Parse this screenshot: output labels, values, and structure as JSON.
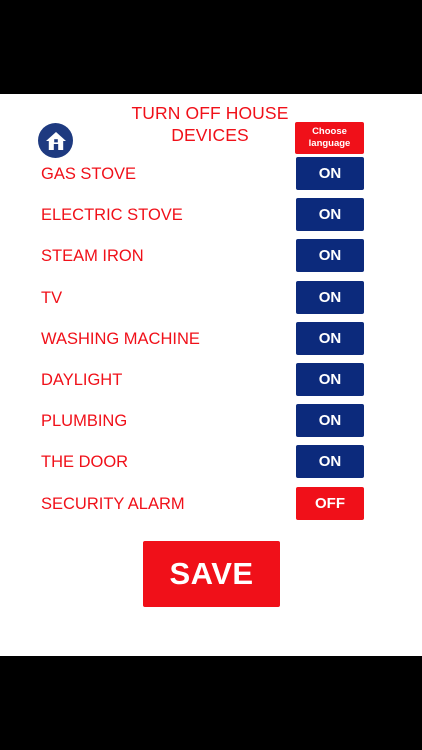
{
  "header": {
    "title_line1": "TURN OFF HOUSE",
    "title_line2": "DEVICES",
    "home_icon": "home-icon",
    "language_button_line1": "Choose",
    "language_button_line2": "language"
  },
  "devices": [
    {
      "label": "GAS STOVE",
      "state": "ON"
    },
    {
      "label": "ELECTRIC STOVE",
      "state": "ON"
    },
    {
      "label": "STEAM IRON",
      "state": "ON"
    },
    {
      "label": "TV",
      "state": "ON"
    },
    {
      "label": "WASHING MACHINE",
      "state": "ON"
    },
    {
      "label": "DAYLIGHT",
      "state": "ON"
    },
    {
      "label": "PLUMBING",
      "state": "ON"
    },
    {
      "label": "THE DOOR",
      "state": "ON"
    },
    {
      "label": "SECURITY ALARM",
      "state": "OFF"
    }
  ],
  "save_label": "SAVE",
  "colors": {
    "accent_red": "#f01019",
    "on_blue": "#0c2a7c",
    "home_blue": "#1e3a80"
  }
}
